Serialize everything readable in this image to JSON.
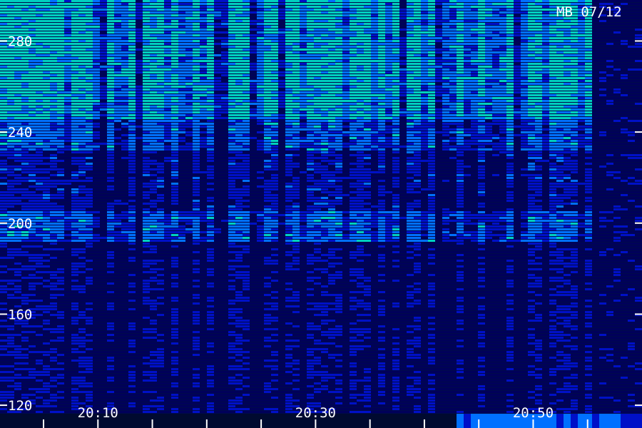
{
  "chart_data": {
    "type": "heatmap",
    "title": "",
    "corner_label": "MB 07/12",
    "xlabel": "",
    "ylabel": "",
    "y_ticks": [
      {
        "value": 280,
        "label": "280"
      },
      {
        "value": 240,
        "label": "240"
      },
      {
        "value": 200,
        "label": "200"
      },
      {
        "value": 160,
        "label": "160"
      },
      {
        "value": 120,
        "label": "120"
      }
    ],
    "x_ticks": [
      {
        "value": "20:10",
        "label": "20:10"
      },
      {
        "value": "20:30",
        "label": "20:30"
      },
      {
        "value": "20:50",
        "label": "20:50"
      }
    ],
    "y_range": [
      110,
      298
    ],
    "x_range": [
      "20:01",
      "21:00"
    ],
    "colormap": [
      "#00005a",
      "#0010c8",
      "#0070ff",
      "#00d0c0",
      "#40ff40"
    ],
    "intensity_bands": [
      {
        "y_from": 245,
        "y_to": 298,
        "level": 0.85
      },
      {
        "y_from": 232,
        "y_to": 245,
        "level": 0.6
      },
      {
        "y_from": 205,
        "y_to": 232,
        "level": 0.35
      },
      {
        "y_from": 192,
        "y_to": 205,
        "level": 0.6
      },
      {
        "y_from": 110,
        "y_to": 192,
        "level": 0.25
      }
    ]
  }
}
